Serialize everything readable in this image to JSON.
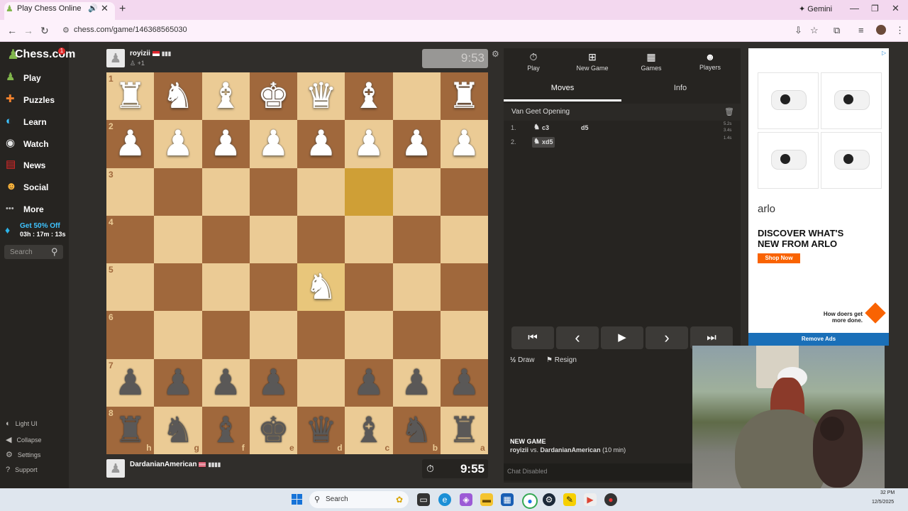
{
  "browser": {
    "tab_title": "Play Chess Online for FREE",
    "gemini_label": "Gemini",
    "url": "chess.com/game/146368565030",
    "icons": [
      "back-icon",
      "forward-icon",
      "reload-icon",
      "install-icon",
      "star-icon",
      "extensions-icon",
      "media-icon",
      "profile-icon",
      "menu-icon"
    ]
  },
  "sidebar": {
    "logo_text": "Chess.com",
    "logo_badge": "1",
    "items": [
      {
        "label": "Play",
        "icon": "play-icon",
        "color": "#81b64c"
      },
      {
        "label": "Puzzles",
        "icon": "puzzles-icon",
        "color": "#f0812d"
      },
      {
        "label": "Learn",
        "icon": "learn-icon",
        "color": "#3ec3ff"
      },
      {
        "label": "Watch",
        "icon": "watch-icon",
        "color": "#e6e6e6"
      },
      {
        "label": "News",
        "icon": "news-icon",
        "color": "#e02828"
      },
      {
        "label": "Social",
        "icon": "social-icon",
        "color": "#f7b23b"
      },
      {
        "label": "More",
        "icon": "more-icon",
        "color": "#bbbbbb"
      }
    ],
    "promo_title": "Get 50% Off",
    "promo_timer": "03h : 17m : 13s",
    "search_placeholder": "Search",
    "footer": [
      {
        "label": "Light UI",
        "icon": "light-ui-icon"
      },
      {
        "label": "Collapse",
        "icon": "collapse-icon"
      },
      {
        "label": "Settings",
        "icon": "settings-icon"
      },
      {
        "label": "Support",
        "icon": "support-icon"
      }
    ]
  },
  "game": {
    "top_player": {
      "name": "royizii",
      "sub": "+1",
      "clock": "9:53"
    },
    "bottom_player": {
      "name": "DardanianAmerican",
      "clock": "9:55"
    },
    "ranks": [
      "1",
      "2",
      "3",
      "4",
      "5",
      "6",
      "7",
      "8"
    ],
    "files": [
      "h",
      "g",
      "f",
      "e",
      "d",
      "c",
      "b",
      "a"
    ],
    "board_rows": [
      [
        "R",
        "N",
        "B",
        "K",
        "Q",
        "B",
        "",
        "R"
      ],
      [
        "P",
        "P",
        "P",
        "P",
        "P",
        "P",
        "P",
        "P"
      ],
      [
        "",
        "",
        "",
        "",
        "",
        "",
        "",
        ""
      ],
      [
        "",
        "",
        "",
        "",
        "",
        "",
        "",
        ""
      ],
      [
        "",
        "",
        "",
        "",
        "N",
        "",
        "",
        ""
      ],
      [
        "",
        "",
        "",
        "",
        "",
        "",
        "",
        ""
      ],
      [
        "p",
        "p",
        "p",
        "p",
        "",
        "p",
        "p",
        "p"
      ],
      [
        "r",
        "n",
        "b",
        "k",
        "q",
        "b",
        "n",
        "r"
      ]
    ],
    "highlighted_squares": [
      "2,5",
      "4,4"
    ],
    "colors": {
      "light": "#ebcb95",
      "dark": "#a0683c",
      "highlight": "#cf9f36"
    }
  },
  "panel": {
    "tabs": [
      {
        "label": "Play",
        "icon": "clock-icon"
      },
      {
        "label": "New Game",
        "icon": "plus-icon"
      },
      {
        "label": "Games",
        "icon": "games-icon"
      },
      {
        "label": "Players",
        "icon": "players-icon"
      }
    ],
    "subtabs": [
      "Moves",
      "Info"
    ],
    "opening": "Van Geet Opening",
    "moves": [
      {
        "num": "1.",
        "white": "c3",
        "black": "d5",
        "times": [
          "5.2s",
          "3.4s"
        ]
      },
      {
        "num": "2.",
        "white": "xd5",
        "black": "",
        "times": [
          "1.4s"
        ]
      }
    ],
    "controls": [
      "first-move",
      "previous-move",
      "play",
      "next-move",
      "last-move"
    ],
    "draw_label": "Draw",
    "draw_prefix": "½",
    "resign_label": "Resign",
    "new_game_heading": "NEW GAME",
    "new_game_white": "royizii",
    "new_game_vs": " vs. ",
    "new_game_black": "DardanianAmerican",
    "new_game_time": " (10 min)",
    "chat": "Chat Disabled"
  },
  "ad": {
    "brand": "arlo",
    "headline": "DISCOVER WHAT'S NEW FROM ARLO",
    "cta": "Shop Now",
    "slogan": "How doers get more done.",
    "remove_ads": "Remove Ads"
  },
  "taskbar": {
    "search_placeholder": "Search",
    "time": "32 PM",
    "date": "12/5/2025"
  }
}
